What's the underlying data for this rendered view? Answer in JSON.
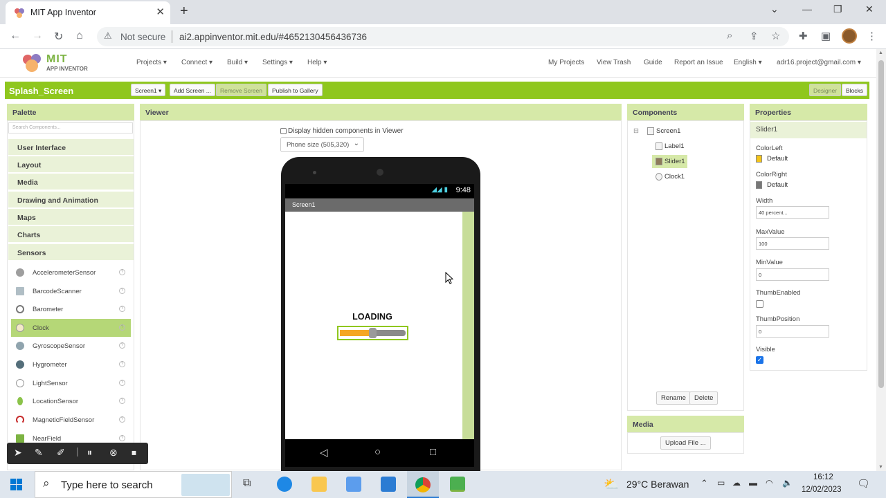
{
  "browser": {
    "tab_title": "MIT App Inventor",
    "url_warning": "Not secure",
    "url": "ai2.appinventor.mit.edu/#4652130456436736"
  },
  "header": {
    "logo_mit": "MIT",
    "logo_sub": "APP INVENTOR",
    "menus": [
      "Projects ▾",
      "Connect ▾",
      "Build ▾",
      "Settings ▾",
      "Help ▾"
    ],
    "right_links": [
      "My Projects",
      "View Trash",
      "Guide",
      "Report an Issue",
      "English ▾",
      "adr16.project@gmail.com ▾"
    ]
  },
  "project": {
    "name": "Splash_Screen",
    "screen_select": "Screen1 ▾",
    "add_screen": "Add Screen ...",
    "remove_screen": "Remove Screen",
    "publish": "Publish to Gallery",
    "designer": "Designer",
    "blocks": "Blocks"
  },
  "palette": {
    "title": "Palette",
    "search_placeholder": "Search Components...",
    "categories": [
      "User Interface",
      "Layout",
      "Media",
      "Drawing and Animation",
      "Maps",
      "Charts",
      "Sensors"
    ],
    "sensors": [
      "AccelerometerSensor",
      "BarcodeScanner",
      "Barometer",
      "Clock",
      "GyroscopeSensor",
      "Hygrometer",
      "LightSensor",
      "LocationSensor",
      "MagneticFieldSensor",
      "NearField"
    ],
    "selected": "Clock"
  },
  "viewer": {
    "title": "Viewer",
    "hidden_check": "Display hidden components in Viewer",
    "phone_size": "Phone size (505,320)",
    "status_time": "9:48",
    "screen_title": "Screen1",
    "loading_label": "LOADING",
    "slider_fraction": 0.5
  },
  "components": {
    "title": "Components",
    "items": [
      "Screen1",
      "Label1",
      "Slider1",
      "Clock1"
    ],
    "selected": "Slider1",
    "rename": "Rename",
    "delete": "Delete"
  },
  "media": {
    "title": "Media",
    "upload": "Upload File ..."
  },
  "properties": {
    "title": "Properties",
    "component": "Slider1",
    "color_left_label": "ColorLeft",
    "color_left_value": "Default",
    "color_left": "#f5c518",
    "color_right_label": "ColorRight",
    "color_right_value": "Default",
    "color_right": "#777777",
    "width_label": "Width",
    "width_value": "40 percent...",
    "maxvalue_label": "MaxValue",
    "maxvalue_value": "100",
    "minvalue_label": "MinValue",
    "minvalue_value": "0",
    "thumbenabled_label": "ThumbEnabled",
    "thumbposition_label": "ThumbPosition",
    "thumbposition_value": "0",
    "visible_label": "Visible"
  },
  "taskbar": {
    "search_placeholder": "Type here to search",
    "weather": "29°C Berawan",
    "time": "16:12",
    "date": "12/02/2023"
  },
  "colors": {
    "accent_green": "#8fc71e",
    "panel_head": "#d6e9a8",
    "slider_left": "#f5a623"
  }
}
